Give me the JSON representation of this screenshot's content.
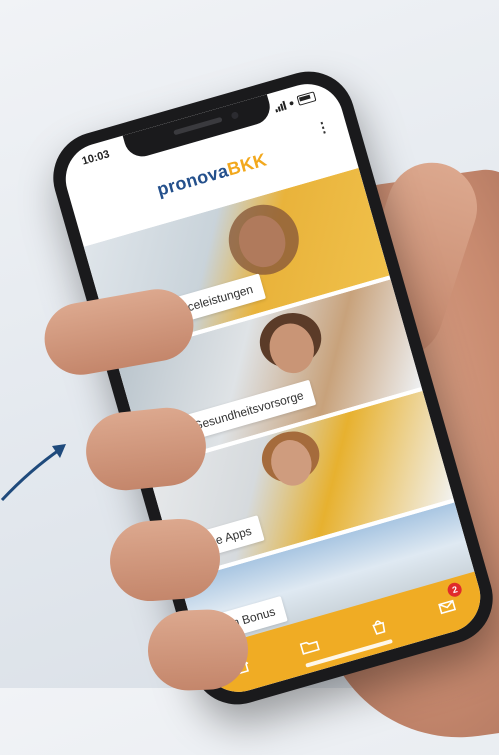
{
  "status_bar": {
    "time": "10:03"
  },
  "header": {
    "logo_part1": "pronova",
    "logo_part2": "BKK",
    "menu_icon": "vertical-dots-icon"
  },
  "tiles": [
    {
      "label": "Meine Serviceleistungen"
    },
    {
      "label": "Meine Gesundheitsvorsorge"
    },
    {
      "label": "Meine Apps"
    },
    {
      "label": "Mein Bonus"
    }
  ],
  "tab_bar": {
    "items": [
      {
        "icon": "home-icon"
      },
      {
        "icon": "folder-icon"
      },
      {
        "icon": "bag-icon"
      },
      {
        "icon": "mail-icon",
        "badge": "2"
      }
    ],
    "color": "#f0ac24"
  },
  "colors": {
    "brand_blue": "#24508c",
    "brand_orange": "#f2a81d",
    "badge_red": "#e02b2b"
  }
}
